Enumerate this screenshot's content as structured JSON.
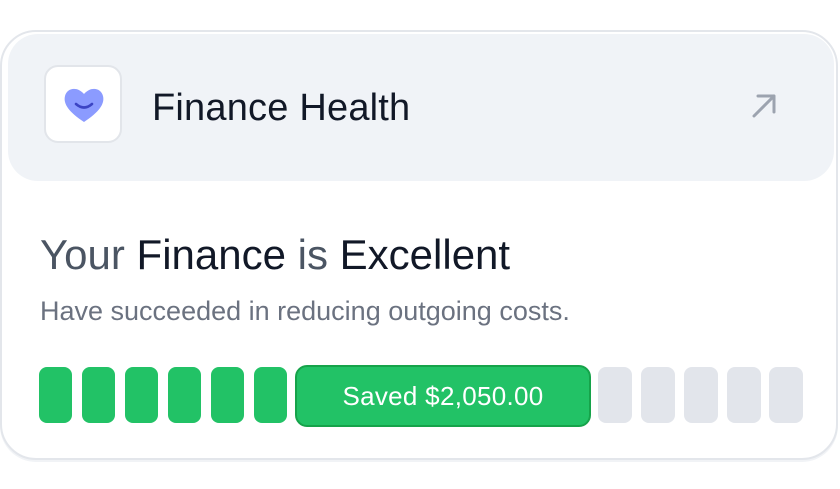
{
  "header": {
    "title": "Finance Health",
    "app_icon": "smiling-heart-icon",
    "action_icon": "arrow-up-right-icon"
  },
  "status": {
    "prefix": "Your",
    "subject": "Finance",
    "verb": "is",
    "rating": "Excellent",
    "description": "Have succeeded in reducing outgoing costs."
  },
  "progress": {
    "label": "Saved $2,050.00",
    "filled_segments": 6,
    "empty_segments": 5,
    "colors": {
      "filled": "#22c266",
      "empty": "#e2e5eb",
      "icon": "#8b9bff"
    }
  }
}
